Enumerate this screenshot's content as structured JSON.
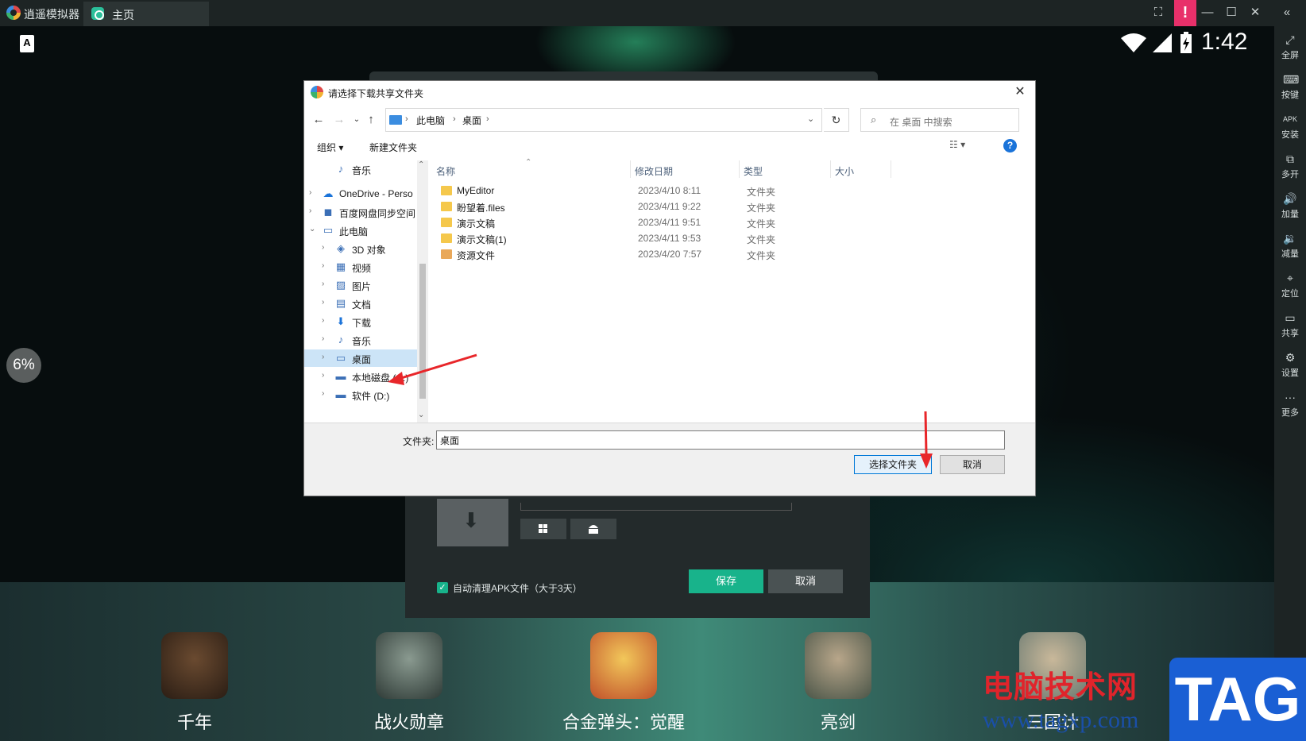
{
  "window": {
    "app_name": "逍遥模拟器",
    "tab_label": "主页",
    "notice": "!",
    "controls": {
      "fit": "⛶",
      "minimize": "—",
      "maximize": "☐",
      "close": "✕",
      "collapse": "«"
    }
  },
  "statusbar": {
    "keyboard_badge": "A",
    "time": "1:42"
  },
  "progress_badge": "6%",
  "sidebar": {
    "items": [
      {
        "icon": "fullscreen-icon",
        "glyph": "⤢",
        "label": "全屏"
      },
      {
        "icon": "keyboard-icon",
        "glyph": "⌨",
        "label": "按键"
      },
      {
        "icon": "apk-icon",
        "glyph": "APK",
        "label": "安装"
      },
      {
        "icon": "multi-open-icon",
        "glyph": "⧉",
        "label": "多开"
      },
      {
        "icon": "volume-up-icon",
        "glyph": "🔊",
        "label": "加量"
      },
      {
        "icon": "volume-down-icon",
        "glyph": "🔉",
        "label": "减量"
      },
      {
        "icon": "location-icon",
        "glyph": "⌖",
        "label": "定位"
      },
      {
        "icon": "share-folder-icon",
        "glyph": "▭",
        "label": "共享"
      },
      {
        "icon": "settings-icon",
        "glyph": "⚙",
        "label": "设置"
      },
      {
        "icon": "more-icon",
        "glyph": "···",
        "label": "更多"
      }
    ]
  },
  "settings_dialog": {
    "auto_clean_label": "自动清理APK文件（大于3天）",
    "save_label": "保存",
    "cancel_label": "取消"
  },
  "apps": [
    {
      "label": "千年",
      "color": "#3a2a20"
    },
    {
      "label": "战火勋章",
      "color": "#4a5a55"
    },
    {
      "label": "合金弹头：觉醒",
      "color": "#d9902a"
    },
    {
      "label": "亮剑",
      "color": "#6a7a6a"
    },
    {
      "label": "三国计",
      "color": "#8a9a8a"
    }
  ],
  "file_dialog": {
    "title": "请选择下载共享文件夹",
    "breadcrumbs": [
      "此电脑",
      "桌面"
    ],
    "search_placeholder": "在 桌面 中搜索",
    "organize_label": "组织 ▾",
    "new_folder_label": "新建文件夹",
    "nav_items": [
      {
        "label": "音乐",
        "glyph": "♪",
        "indent": 1,
        "expander": false,
        "selected": false
      },
      {
        "label": "OneDrive - Perso",
        "glyph": "☁",
        "indent": 0,
        "expander": true,
        "selected": false
      },
      {
        "label": "百度网盘同步空间",
        "glyph": "◼",
        "indent": 0,
        "expander": true,
        "selected": false
      },
      {
        "label": "此电脑",
        "glyph": "▭",
        "indent": 0,
        "expander": true,
        "selected": false,
        "open": true
      },
      {
        "label": "3D 对象",
        "glyph": "◈",
        "indent": 1,
        "expander": true,
        "selected": false
      },
      {
        "label": "视频",
        "glyph": "▦",
        "indent": 1,
        "expander": true,
        "selected": false
      },
      {
        "label": "图片",
        "glyph": "▨",
        "indent": 1,
        "expander": true,
        "selected": false
      },
      {
        "label": "文档",
        "glyph": "▤",
        "indent": 1,
        "expander": true,
        "selected": false
      },
      {
        "label": "下载",
        "glyph": "⬇",
        "indent": 1,
        "expander": true,
        "selected": false
      },
      {
        "label": "音乐",
        "glyph": "♪",
        "indent": 1,
        "expander": true,
        "selected": false
      },
      {
        "label": "桌面",
        "glyph": "▭",
        "indent": 1,
        "expander": true,
        "selected": true
      },
      {
        "label": "本地磁盘 (C:)",
        "glyph": "▬",
        "indent": 1,
        "expander": true,
        "selected": false
      },
      {
        "label": "软件 (D:)",
        "glyph": "▬",
        "indent": 1,
        "expander": true,
        "selected": false
      }
    ],
    "columns": {
      "name": "名称",
      "date": "修改日期",
      "type": "类型",
      "size": "大小"
    },
    "files": [
      {
        "name": "MyEditor",
        "date": "2023/4/10 8:11",
        "type": "文件夹",
        "special": false
      },
      {
        "name": "盼望着.files",
        "date": "2023/4/11 9:22",
        "type": "文件夹",
        "special": false
      },
      {
        "name": "演示文稿",
        "date": "2023/4/11 9:51",
        "type": "文件夹",
        "special": false
      },
      {
        "name": "演示文稿(1)",
        "date": "2023/4/11 9:53",
        "type": "文件夹",
        "special": false
      },
      {
        "name": "资源文件",
        "date": "2023/4/20 7:57",
        "type": "文件夹",
        "special": true
      }
    ],
    "folder_label": "文件夹:",
    "folder_value": "桌面",
    "select_label": "选择文件夹",
    "cancel_label": "取消"
  },
  "watermark": {
    "title": "电脑技术网",
    "url": "www.tagxp.com",
    "tag": "TAG"
  }
}
